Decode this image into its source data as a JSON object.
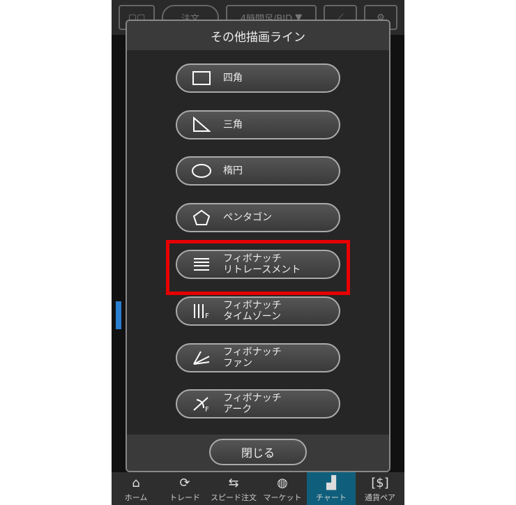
{
  "topbar": {
    "order_label": "注文",
    "timeframe": "4時間足/BID"
  },
  "modal": {
    "title": "その他描画ライン",
    "items": [
      {
        "label": "四角",
        "icon": "rectangle-icon"
      },
      {
        "label": "三角",
        "icon": "triangle-icon"
      },
      {
        "label": "楕円",
        "icon": "ellipse-icon"
      },
      {
        "label": "ペンタゴン",
        "icon": "pentagon-icon"
      },
      {
        "label1": "フィボナッチ",
        "label2": "リトレースメント",
        "icon": "fibonacci-retracement-icon",
        "highlighted": true
      },
      {
        "label1": "フィボナッチ",
        "label2": "タイムゾーン",
        "icon": "fibonacci-timezone-icon"
      },
      {
        "label1": "フィボナッチ",
        "label2": "ファン",
        "icon": "fibonacci-fan-icon"
      },
      {
        "label1": "フィボナッチ",
        "label2": "アーク",
        "icon": "fibonacci-arc-icon"
      }
    ],
    "close_label": "閉じる",
    "highlight_color": "#e60000"
  },
  "tabs": [
    {
      "label": "ホーム",
      "icon": "home-icon"
    },
    {
      "label": "トレード",
      "icon": "trade-icon"
    },
    {
      "label": "スピード注文",
      "icon": "speed-order-icon"
    },
    {
      "label": "マーケット",
      "icon": "globe-icon"
    },
    {
      "label": "チャート",
      "icon": "chart-icon",
      "active": true
    },
    {
      "label": "通貨ペア",
      "icon": "currency-pair-icon"
    }
  ]
}
